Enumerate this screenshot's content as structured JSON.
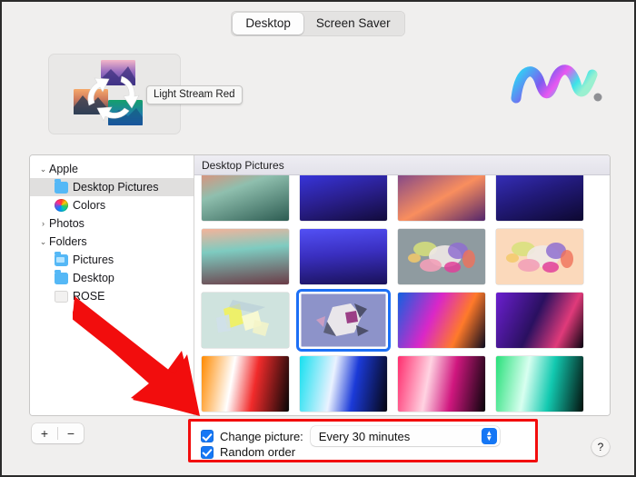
{
  "window": {
    "tabs": [
      {
        "label": "Desktop",
        "active": true
      },
      {
        "label": "Screen Saver",
        "active": false
      }
    ]
  },
  "preview": {
    "tooltip": "Light Stream Red",
    "icon_name": "rotating-wallpaper-icon"
  },
  "brand": {
    "icon_name": "macreports-wave-logo"
  },
  "sidebar": {
    "items": [
      {
        "label": "Apple",
        "level": 0,
        "disclosure": "⌄",
        "icon": "none",
        "selected": false
      },
      {
        "label": "Desktop Pictures",
        "level": 1,
        "disclosure": "",
        "icon": "folder-blue",
        "selected": true
      },
      {
        "label": "Colors",
        "level": 1,
        "disclosure": "",
        "icon": "color-wheel",
        "selected": false
      },
      {
        "label": "Photos",
        "level": 0,
        "disclosure": "›",
        "icon": "none",
        "selected": false
      },
      {
        "label": "Folders",
        "level": 0,
        "disclosure": "⌄",
        "icon": "none",
        "selected": false
      },
      {
        "label": "Pictures",
        "level": 1,
        "disclosure": "",
        "icon": "folder-pictures",
        "selected": false
      },
      {
        "label": "Desktop",
        "level": 1,
        "disclosure": "",
        "icon": "folder-blue",
        "selected": false
      },
      {
        "label": "ROSE",
        "level": 1,
        "disclosure": "",
        "icon": "folder-dim",
        "selected": false
      }
    ],
    "add_label": "+",
    "remove_label": "−"
  },
  "grid": {
    "header": "Desktop Pictures",
    "selected_index": 9,
    "rows": [
      [
        {
          "name": "big-sur-morning-cliffs",
          "css": "linear-gradient(160deg,#f2856e 0%,#8fbfae 40%,#2d5c52 100%)"
        },
        {
          "name": "big-sur-night-shore",
          "css": "linear-gradient(165deg,#3b3af0 0%,#2a1f8e 55%,#120b3b 100%)"
        },
        {
          "name": "big-sur-sunset-dunes",
          "css": "linear-gradient(150deg,#6e3b8f 0%,#f98e5e 55%,#52256b 100%)"
        },
        {
          "name": "big-sur-deep-night",
          "css": "linear-gradient(160deg,#3a33c8 0%,#221a7a 50%,#0d0830 100%)"
        }
      ],
      [
        {
          "name": "big-sur-coast-dawn",
          "css": "linear-gradient(175deg,#f4b39a 0%,#7ecbc0 38%,#6b3b46 100%)"
        },
        {
          "name": "big-sur-coast-night",
          "css": "linear-gradient(175deg,#5250f5 0%,#3a2fc0 45%,#191158 100%)"
        },
        {
          "name": "abstract-pebbles-gray",
          "css": "#8f9ba0"
        },
        {
          "name": "abstract-pebbles-peach",
          "css": "#fbd9bb"
        }
      ],
      [
        {
          "name": "abstract-shards-mint",
          "css": "#cfe3de"
        },
        {
          "name": "abstract-sphere-violet",
          "css": "#8d93c9"
        },
        {
          "name": "abstract-swirl-magenta",
          "css": "linear-gradient(115deg,#1161e0 0%,#d927c8 40%,#ff7a2a 70%,#0a0a1e 100%)"
        },
        {
          "name": "abstract-swirl-purple",
          "css": "linear-gradient(115deg,#6b1fd0 0%,#2a1060 45%,#e03a7a 75%,#07030f 100%)"
        }
      ],
      [
        {
          "name": "abstract-flare-orange",
          "css": "linear-gradient(100deg,#ff8a00 0%,#ffffff 35%,#f12b2b 60%,#060606 100%)"
        },
        {
          "name": "abstract-flare-blue",
          "css": "linear-gradient(100deg,#16e0f0 0%,#eaf2ff 38%,#1b3ad8 62%,#050510 100%)"
        },
        {
          "name": "abstract-flare-pink",
          "css": "linear-gradient(100deg,#ff2d6e 0%,#ffd3e2 35%,#d0177f 62%,#08040a 100%)"
        },
        {
          "name": "abstract-flare-green",
          "css": "linear-gradient(100deg,#28e07a 0%,#d8fff0 35%,#12c9b0 62%,#04100c 100%)"
        }
      ]
    ]
  },
  "options": {
    "change_picture_label": "Change picture:",
    "change_picture_checked": true,
    "interval_value": "Every 30 minutes",
    "random_order_label": "Random order",
    "random_order_checked": true
  },
  "help": {
    "label": "?"
  },
  "annotation": {
    "arrow_color": "#f20d0d",
    "highlight_color": "#f20d0d"
  },
  "colors": {
    "accent": "#1577f5",
    "selection_outline": "#1c6ff5",
    "sidebar_selected_bg": "#e0dfde"
  }
}
